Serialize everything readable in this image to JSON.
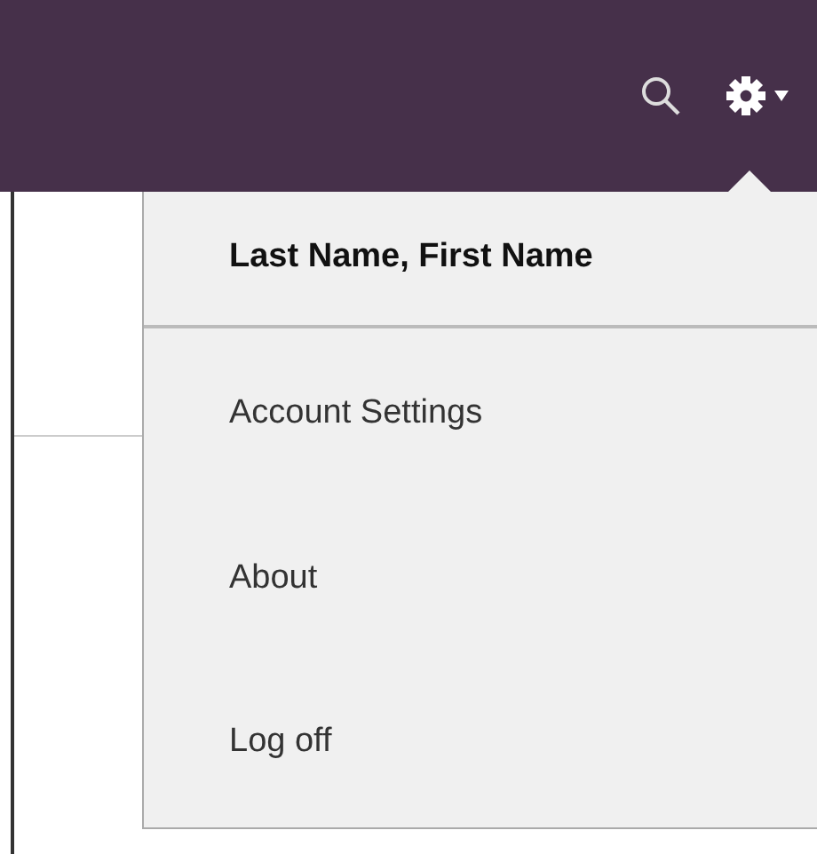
{
  "menu": {
    "user_name": "Last Name, First Name",
    "items": [
      {
        "label": "Account Settings"
      },
      {
        "label": "About"
      },
      {
        "label": "Log off"
      }
    ]
  }
}
